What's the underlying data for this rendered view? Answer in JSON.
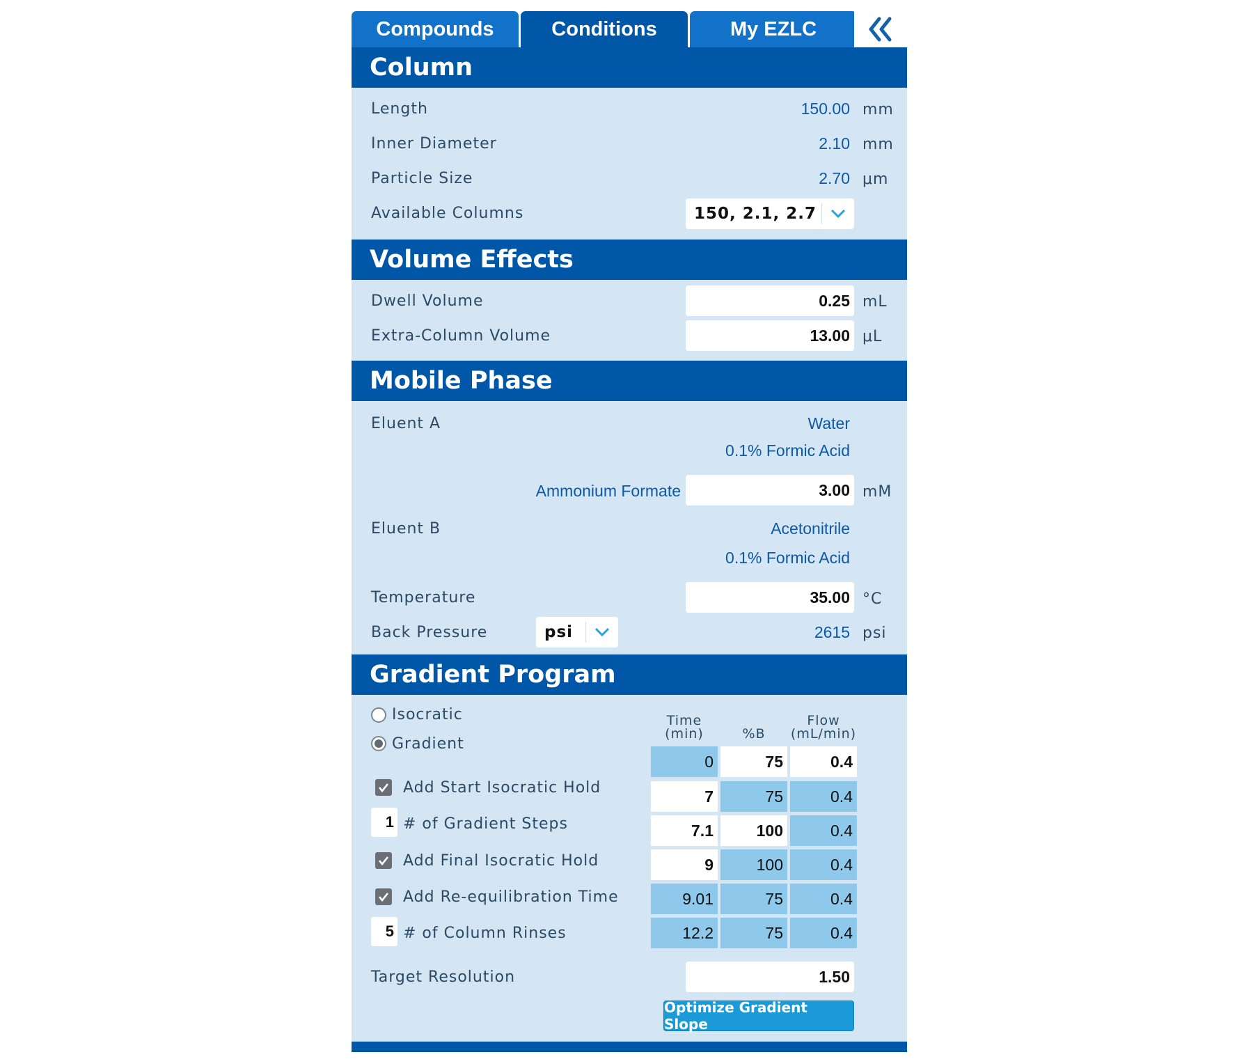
{
  "tabs": [
    {
      "label": "Compounds"
    },
    {
      "label": "Conditions"
    },
    {
      "label": "My EZLC"
    }
  ],
  "active_tab": "Conditions",
  "collapse_icon": "double-chevron-left-icon",
  "colors": {
    "header": "#0057a8",
    "panel": "#d4e6f3",
    "tab": "#1272c9",
    "accent_button": "#1c9ad8",
    "cell_highlight": "#8ec8ea"
  },
  "column": {
    "title": "Column",
    "length": {
      "label": "Length",
      "value": "150.00",
      "unit": "mm"
    },
    "inner_diameter": {
      "label": "Inner Diameter",
      "value": "2.10",
      "unit": "mm"
    },
    "particle_size": {
      "label": "Particle Size",
      "value": "2.70",
      "unit": "μm"
    },
    "available_columns": {
      "label": "Available Columns",
      "selected": "150, 2.1, 2.7"
    }
  },
  "volume_effects": {
    "title": "Volume Effects",
    "dwell_volume": {
      "label": "Dwell Volume",
      "value": "0.25",
      "unit": "mL"
    },
    "extra_column_volume": {
      "label": "Extra-Column Volume",
      "value": "13.00",
      "unit": "μL"
    }
  },
  "mobile_phase": {
    "title": "Mobile Phase",
    "eluent_a": {
      "label": "Eluent A",
      "solvent": "Water",
      "additive": "0.1% Formic Acid"
    },
    "ammonium_formate": {
      "label": "Ammonium Formate",
      "value": "3.00",
      "unit": "mM"
    },
    "eluent_b": {
      "label": "Eluent B",
      "solvent": "Acetonitrile",
      "additive": "0.1% Formic Acid"
    },
    "temperature": {
      "label": "Temperature",
      "value": "35.00",
      "unit": "°C"
    },
    "back_pressure": {
      "label": "Back Pressure",
      "unit_select": "psi",
      "value": "2615",
      "unit": "psi"
    }
  },
  "gradient_program": {
    "title": "Gradient Program",
    "isocratic_label": "Isocratic",
    "gradient_label": "Gradient",
    "mode_selected": "Gradient",
    "add_start_hold": {
      "label": "Add Start Isocratic Hold",
      "checked": true
    },
    "gradient_steps": {
      "label": "# of Gradient Steps",
      "value": "1"
    },
    "add_final_hold": {
      "label": "Add Final Isocratic Hold",
      "checked": true
    },
    "add_reequilibration": {
      "label": "Add Re-equilibration Time",
      "checked": true
    },
    "column_rinses": {
      "label": "# of Column Rinses",
      "value": "5"
    },
    "columns": [
      {
        "line1": "Time",
        "line2": "(min)"
      },
      {
        "line1": "",
        "line2": "%B"
      },
      {
        "line1": "Flow",
        "line2": "(mL/min)"
      }
    ],
    "rows": [
      {
        "time": "0",
        "b": "75",
        "flow": "0.4"
      },
      {
        "time": "7",
        "b": "75",
        "flow": "0.4"
      },
      {
        "time": "7.1",
        "b": "100",
        "flow": "0.4"
      },
      {
        "time": "9",
        "b": "100",
        "flow": "0.4"
      },
      {
        "time": "9.01",
        "b": "75",
        "flow": "0.4"
      },
      {
        "time": "12.2",
        "b": "75",
        "flow": "0.4"
      }
    ],
    "target_resolution": {
      "label": "Target Resolution",
      "value": "1.50"
    },
    "optimize_button": "Optimize Gradient Slope"
  }
}
